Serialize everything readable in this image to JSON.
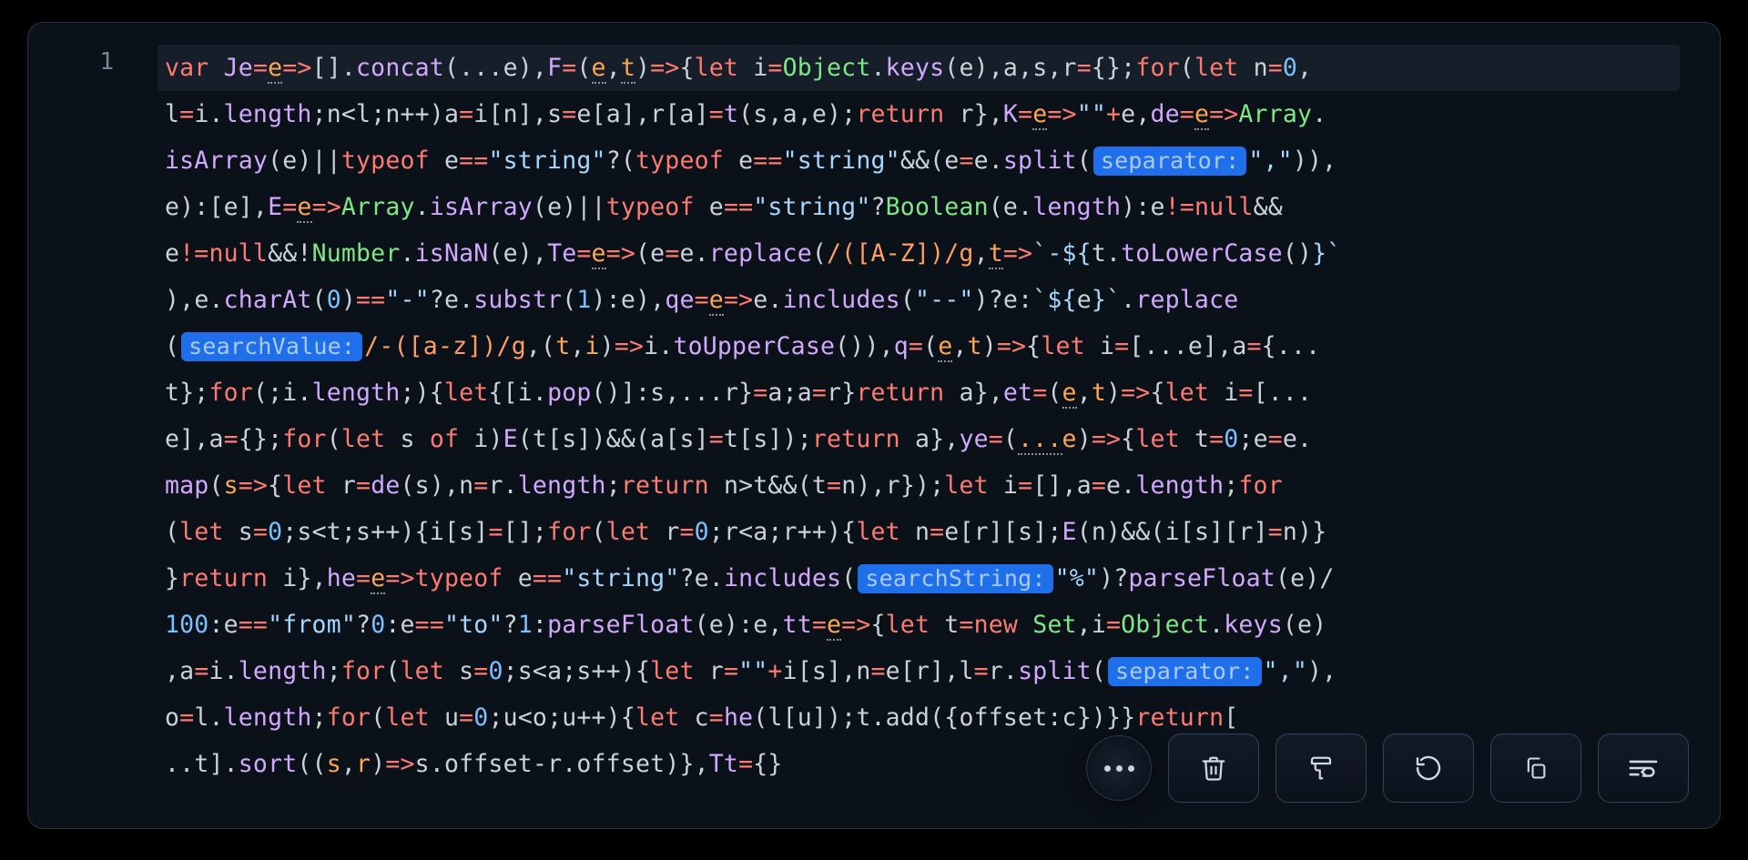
{
  "editor": {
    "line_number": "1",
    "inlay_hints": {
      "separator1_label": "separator:",
      "searchValue_label": "searchValue:",
      "searchString_label": "searchString:",
      "separator2_label": "separator:"
    },
    "toolbar": {
      "more": "more-actions",
      "delete": "delete",
      "format": "format-code",
      "revert": "revert",
      "copy": "copy",
      "wrap": "word-wrap"
    },
    "code_tokens": {
      "var": "var",
      "let": "let",
      "for": "for",
      "of": "of",
      "return": "return",
      "typeof": "typeof",
      "new": "new",
      "null": "null",
      "concat": "concat",
      "keys": "keys",
      "length": "length",
      "isArray": "isArray",
      "split": "split",
      "isNaN": "isNaN",
      "replace": "replace",
      "toLowerCase": "toLowerCase",
      "charAt": "charAt",
      "substr": "substr",
      "includes": "includes",
      "toUpperCase": "toUpperCase",
      "pop": "pop",
      "map": "map",
      "parseFloat": "parseFloat",
      "sort": "sort",
      "Object": "Object",
      "Array": "Array",
      "Boolean": "Boolean",
      "Number": "Number",
      "Set": "Set",
      "Je": "Je",
      "F": "F",
      "K": "K",
      "de": "de",
      "E": "E",
      "Te": "Te",
      "qe": "qe",
      "q": "q",
      "et": "et",
      "ye": "ye",
      "he": "he",
      "tt": "tt",
      "Tt": "Tt",
      "e": "e",
      "t": "t",
      "i": "i",
      "a": "a",
      "s": "s",
      "r": "r",
      "n": "n",
      "l": "l",
      "o": "o",
      "u": "u",
      "c": "c",
      "str_string": "\"string\"",
      "str_comma": "\",\"",
      "str_dashdash": "\"--\"",
      "str_dash": "\"-\"",
      "str_empty": "\"\"",
      "str_pct": "\"%\"",
      "str_from": "\"from\"",
      "str_to": "\"to\"",
      "regex_AZ": "/([A-Z])/g",
      "regex_az": "/-([a-z])/g",
      "n0": "0",
      "n1": "1",
      "n100": "100",
      "tpl_dash_open": "`-${",
      "tpl_close": "}`",
      "tpl_open": "`${",
      "tpl_e_close": "}`",
      "offset": "offset"
    }
  }
}
